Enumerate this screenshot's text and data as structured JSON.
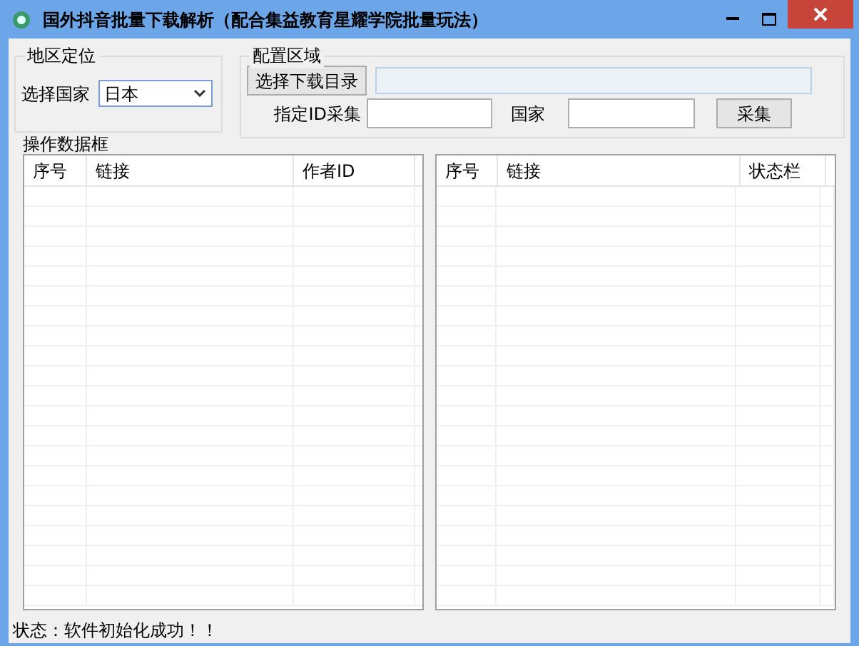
{
  "window": {
    "title": "国外抖音批量下载解析（配合集益教育星耀学院批量玩法）"
  },
  "region_group": {
    "title": "地区定位",
    "label": "选择国家",
    "country_select": {
      "value": "日本"
    }
  },
  "config_group": {
    "title": "配置区域",
    "choose_dir_button": "选择下载目录",
    "id_label": "指定ID采集",
    "country_label": "国家",
    "collect_button": "采集"
  },
  "data_group": {
    "title": "操作数据框",
    "left_table": {
      "columns": [
        "序号",
        "链接",
        "作者ID"
      ]
    },
    "right_table": {
      "columns": [
        "序号",
        "链接",
        "状态栏"
      ]
    }
  },
  "status_bar": "状态：软件初始化成功！！"
}
